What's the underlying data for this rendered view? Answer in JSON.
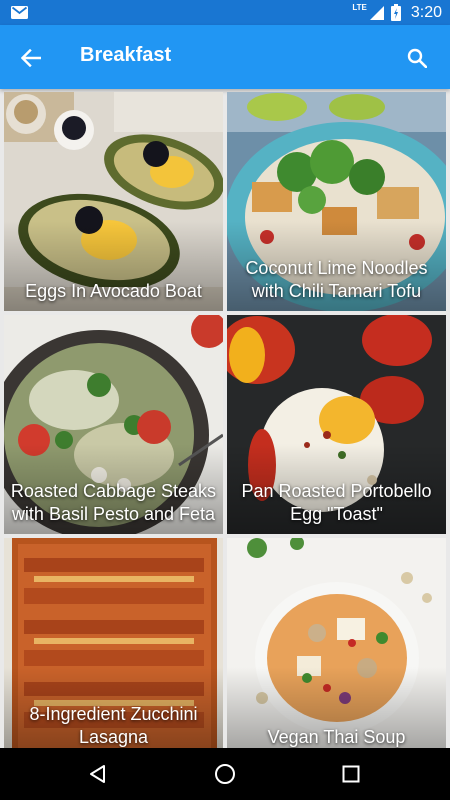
{
  "status_bar": {
    "time": "3:20",
    "network": "LTE",
    "icons": [
      "gmail-icon",
      "signal-icon",
      "battery-icon"
    ]
  },
  "app_bar": {
    "title": "Breakfast",
    "back_icon": "arrow-back-icon",
    "search_icon": "search-icon",
    "color": "#2196f3",
    "status_color": "#1976d2"
  },
  "recipes": [
    {
      "title": "Eggs In Avocado Boat"
    },
    {
      "title": "Coconut Lime Noodles with Chili Tamari Tofu"
    },
    {
      "title": "Roasted Cabbage Steaks with Basil Pesto and Feta"
    },
    {
      "title": "Pan Roasted Portobello Egg \"Toast\""
    },
    {
      "title": "8-Ingredient Zucchini Lasagna"
    },
    {
      "title": "Vegan Thai Soup"
    }
  ],
  "nav_bar": {
    "back_icon": "nav-back-icon",
    "home_icon": "nav-home-icon",
    "recents_icon": "nav-recents-icon"
  }
}
